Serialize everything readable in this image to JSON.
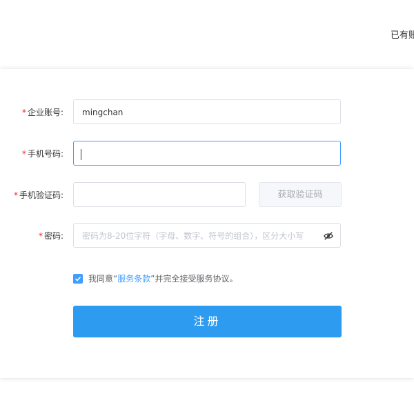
{
  "header": {
    "login_link": "已有账号"
  },
  "form": {
    "account": {
      "label": "企业账号:",
      "value": "mingchan"
    },
    "phone": {
      "label": "手机号码:",
      "value": ""
    },
    "sms_code": {
      "label": "手机验证码:",
      "value": "",
      "button": "获取验证码"
    },
    "password": {
      "label": "密码:",
      "placeholder": "密码为8-20位字符（字母、数字、符号的组合），区分大小写"
    },
    "agreement": {
      "checked": true,
      "prefix": "我同意“",
      "link": "服务条款",
      "suffix": "”并完全接受服务协议。"
    },
    "submit_label": "注册"
  },
  "colors": {
    "primary": "#2d9bf0",
    "required": "#f5222d",
    "link": "#409eff"
  },
  "icons": {
    "password_toggle": "eye-off-icon",
    "checkbox": "check-icon"
  }
}
